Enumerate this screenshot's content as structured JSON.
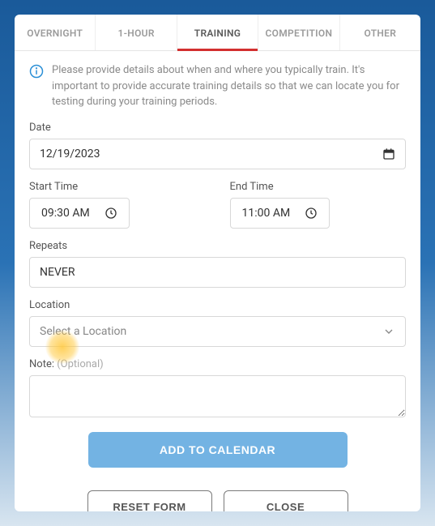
{
  "tabs": {
    "overnight": "OVERNIGHT",
    "one_hour": "1-HOUR",
    "training": "TRAINING",
    "competition": "COMPETITION",
    "other": "OTHER"
  },
  "info_text": "Please provide details about when and where you typically train. It's important to provide accurate training details so that we can locate you for testing during your training periods.",
  "date": {
    "label": "Date",
    "value": "12/19/2023"
  },
  "start_time": {
    "label": "Start Time",
    "value": "09:30 AM"
  },
  "end_time": {
    "label": "End Time",
    "value": "11:00 AM"
  },
  "repeats": {
    "label": "Repeats",
    "value": "NEVER"
  },
  "location": {
    "label": "Location",
    "placeholder": "Select a Location"
  },
  "note": {
    "label": "Note:",
    "optional": "(Optional)"
  },
  "buttons": {
    "add": "ADD TO CALENDAR",
    "reset": "RESET FORM",
    "close": "CLOSE"
  }
}
